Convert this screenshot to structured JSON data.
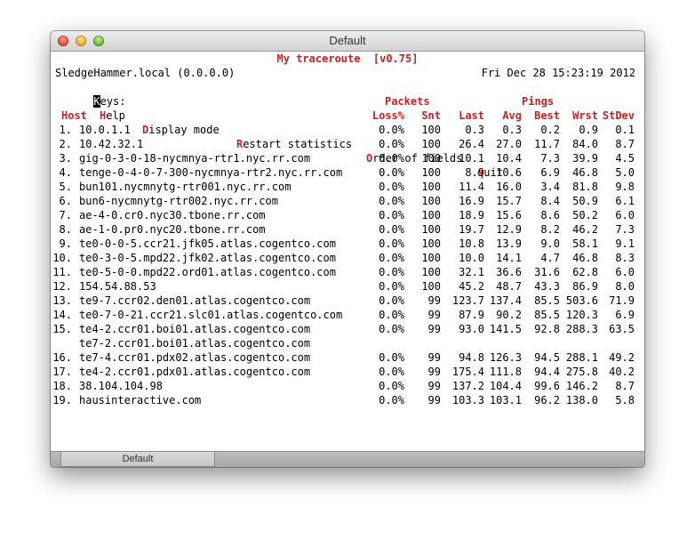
{
  "window": {
    "title": "Default",
    "tab_label": "Default"
  },
  "app_title": "My traceroute  [v0.75]",
  "host_line": "SledgeHammer.local (0.0.0.0)",
  "datetime": "Fri Dec 28 15:23:19 2012",
  "keys": {
    "label": "eys:",
    "label_key": "K",
    "help_key": "H",
    "help_text": "elp",
    "display_key": "D",
    "display_text": "isplay mode",
    "restart_key": "R",
    "restart_text": "estart statistics",
    "order_key": "O",
    "order_text": "rder of fields",
    "quit_key": "q",
    "quit_text": "uit"
  },
  "headers": {
    "packets": "Packets",
    "pings": "Pings",
    "host": "Host",
    "loss": "Loss%",
    "snt": "Snt",
    "last": "Last",
    "avg": "Avg",
    "best": "Best",
    "wrst": "Wrst",
    "stdev": "StDev"
  },
  "rows": [
    {
      "num": "1.",
      "host": "10.0.1.1",
      "loss": "0.0%",
      "snt": "100",
      "last": "0.3",
      "avg": "0.3",
      "best": "0.2",
      "wrst": "0.9",
      "stdev": "0.1"
    },
    {
      "num": "2.",
      "host": "10.42.32.1",
      "loss": "0.0%",
      "snt": "100",
      "last": "26.4",
      "avg": "27.0",
      "best": "11.7",
      "wrst": "84.0",
      "stdev": "8.7"
    },
    {
      "num": "3.",
      "host": "gig-0-3-0-18-nycmnya-rtr1.nyc.rr.com",
      "loss": "0.0%",
      "snt": "100",
      "last": "10.1",
      "avg": "10.4",
      "best": "7.3",
      "wrst": "39.9",
      "stdev": "4.5"
    },
    {
      "num": "4.",
      "host": "tenge-0-4-0-7-300-nycmnya-rtr2.nyc.rr.com",
      "loss": "0.0%",
      "snt": "100",
      "last": "8.9",
      "avg": "10.6",
      "best": "6.9",
      "wrst": "46.8",
      "stdev": "5.0"
    },
    {
      "num": "5.",
      "host": "bun101.nycmnytg-rtr001.nyc.rr.com",
      "loss": "0.0%",
      "snt": "100",
      "last": "11.4",
      "avg": "16.0",
      "best": "3.4",
      "wrst": "81.8",
      "stdev": "9.8"
    },
    {
      "num": "6.",
      "host": "bun6-nycmnytg-rtr002.nyc.rr.com",
      "loss": "0.0%",
      "snt": "100",
      "last": "16.9",
      "avg": "15.7",
      "best": "8.4",
      "wrst": "50.9",
      "stdev": "6.1"
    },
    {
      "num": "7.",
      "host": "ae-4-0.cr0.nyc30.tbone.rr.com",
      "loss": "0.0%",
      "snt": "100",
      "last": "18.9",
      "avg": "15.6",
      "best": "8.6",
      "wrst": "50.2",
      "stdev": "6.0"
    },
    {
      "num": "8.",
      "host": "ae-1-0.pr0.nyc20.tbone.rr.com",
      "loss": "0.0%",
      "snt": "100",
      "last": "19.7",
      "avg": "12.9",
      "best": "8.2",
      "wrst": "46.2",
      "stdev": "7.3"
    },
    {
      "num": "9.",
      "host": "te0-0-0-5.ccr21.jfk05.atlas.cogentco.com",
      "loss": "0.0%",
      "snt": "100",
      "last": "10.8",
      "avg": "13.9",
      "best": "9.0",
      "wrst": "58.1",
      "stdev": "9.1"
    },
    {
      "num": "10.",
      "host": "te0-3-0-5.mpd22.jfk02.atlas.cogentco.com",
      "loss": "0.0%",
      "snt": "100",
      "last": "10.0",
      "avg": "14.1",
      "best": "4.7",
      "wrst": "46.8",
      "stdev": "8.3"
    },
    {
      "num": "11.",
      "host": "te0-5-0-0.mpd22.ord01.atlas.cogentco.com",
      "loss": "0.0%",
      "snt": "100",
      "last": "32.1",
      "avg": "36.6",
      "best": "31.6",
      "wrst": "62.8",
      "stdev": "6.0"
    },
    {
      "num": "12.",
      "host": "154.54.88.53",
      "loss": "0.0%",
      "snt": "100",
      "last": "45.2",
      "avg": "48.7",
      "best": "43.3",
      "wrst": "86.9",
      "stdev": "8.0"
    },
    {
      "num": "13.",
      "host": "te9-7.ccr02.den01.atlas.cogentco.com",
      "loss": "0.0%",
      "snt": "99",
      "last": "123.7",
      "avg": "137.4",
      "best": "85.5",
      "wrst": "503.6",
      "stdev": "71.9"
    },
    {
      "num": "14.",
      "host": "te0-7-0-21.ccr21.slc01.atlas.cogentco.com",
      "loss": "0.0%",
      "snt": "99",
      "last": "87.9",
      "avg": "90.2",
      "best": "85.5",
      "wrst": "120.3",
      "stdev": "6.9"
    },
    {
      "num": "15.",
      "host": "te4-2.ccr01.boi01.atlas.cogentco.com",
      "loss": "0.0%",
      "snt": "99",
      "last": "93.0",
      "avg": "141.5",
      "best": "92.8",
      "wrst": "288.3",
      "stdev": "63.5"
    },
    {
      "num": "",
      "host": "te7-2.ccr01.boi01.atlas.cogentco.com",
      "loss": "",
      "snt": "",
      "last": "",
      "avg": "",
      "best": "",
      "wrst": "",
      "stdev": ""
    },
    {
      "num": "16.",
      "host": "te7-4.ccr01.pdx02.atlas.cogentco.com",
      "loss": "0.0%",
      "snt": "99",
      "last": "94.8",
      "avg": "126.3",
      "best": "94.5",
      "wrst": "288.1",
      "stdev": "49.2"
    },
    {
      "num": "17.",
      "host": "te4-2.ccr01.pdx01.atlas.cogentco.com",
      "loss": "0.0%",
      "snt": "99",
      "last": "175.4",
      "avg": "111.8",
      "best": "94.4",
      "wrst": "275.8",
      "stdev": "40.2"
    },
    {
      "num": "18.",
      "host": "38.104.104.98",
      "loss": "0.0%",
      "snt": "99",
      "last": "137.2",
      "avg": "104.4",
      "best": "99.6",
      "wrst": "146.2",
      "stdev": "8.7"
    },
    {
      "num": "19.",
      "host": "hausinteractive.com",
      "loss": "0.0%",
      "snt": "99",
      "last": "103.3",
      "avg": "103.1",
      "best": "96.2",
      "wrst": "138.0",
      "stdev": "5.8"
    }
  ]
}
